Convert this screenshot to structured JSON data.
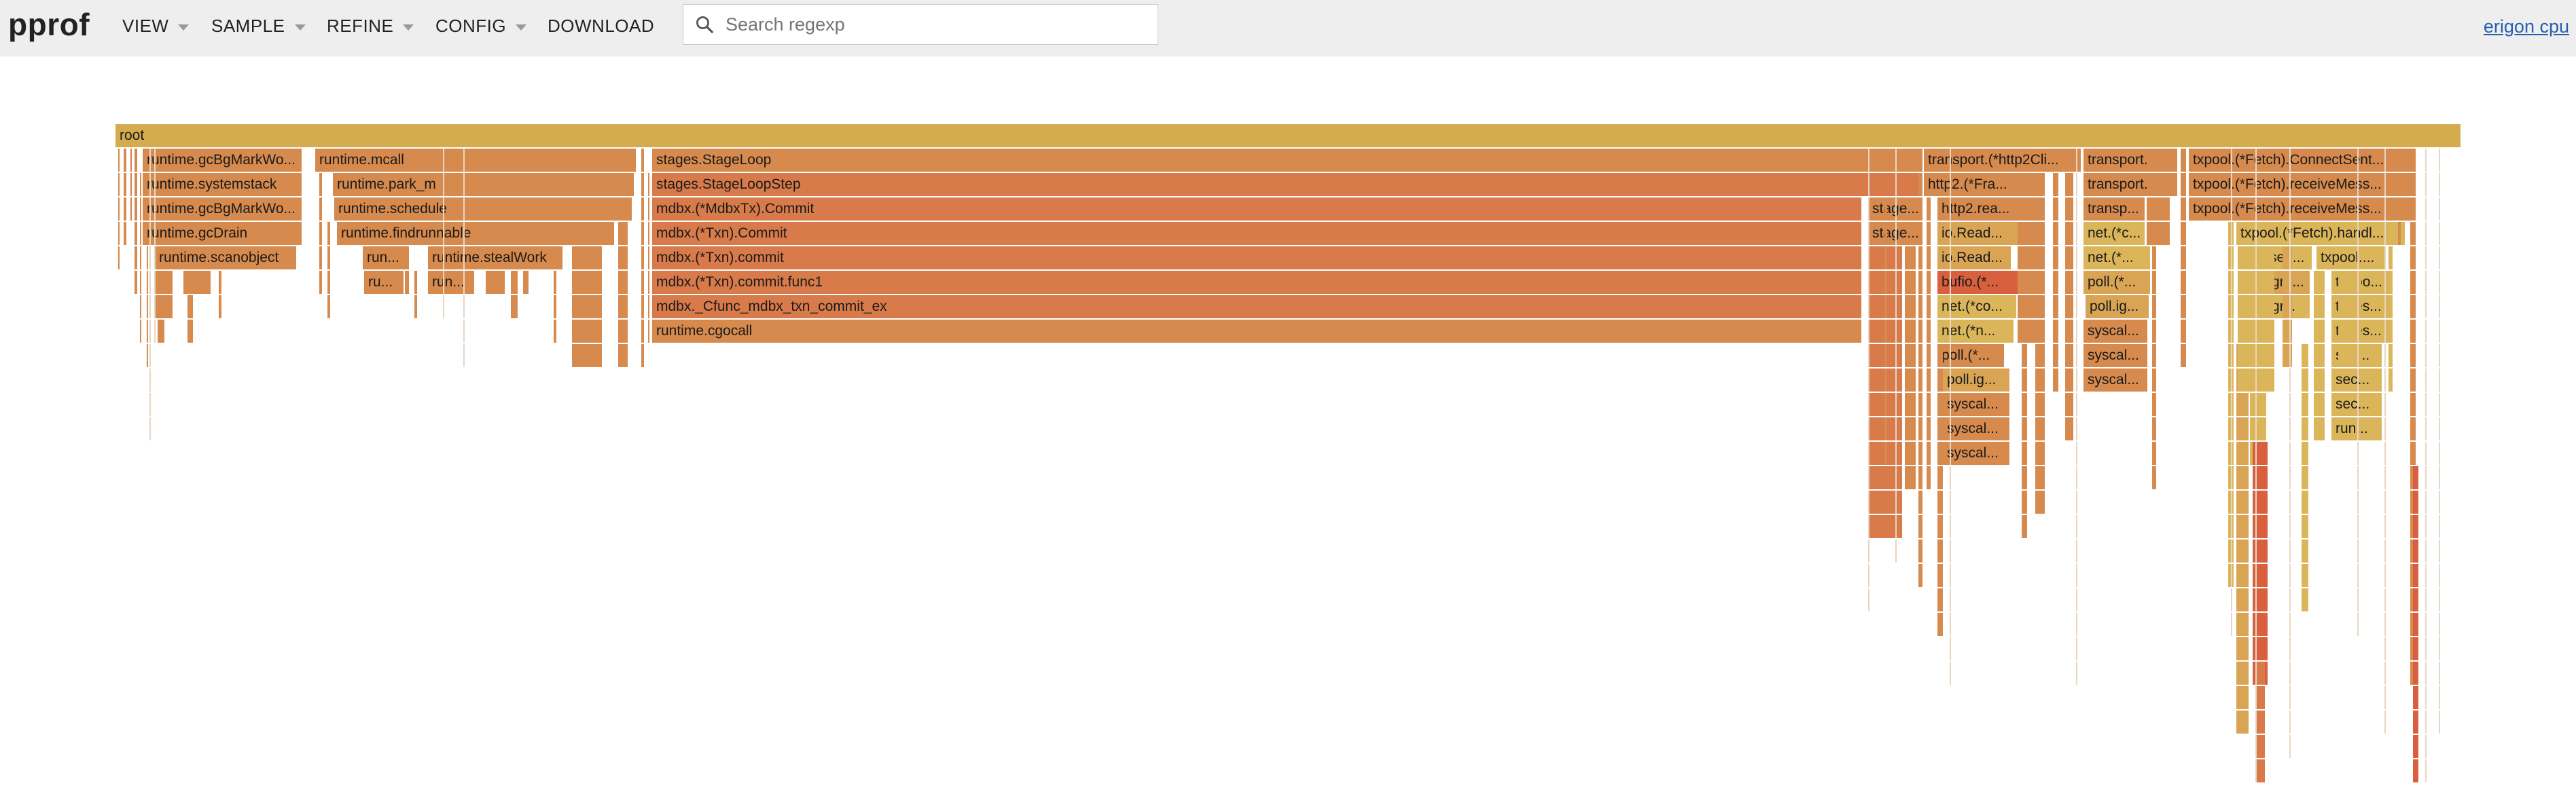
{
  "app": {
    "logo": "pprof",
    "profile_link": "erigon cpu"
  },
  "menu": [
    {
      "label": "VIEW",
      "dropdown": true
    },
    {
      "label": "SAMPLE",
      "dropdown": true
    },
    {
      "label": "REFINE",
      "dropdown": true
    },
    {
      "label": "CONFIG",
      "dropdown": true
    },
    {
      "label": "DOWNLOAD",
      "dropdown": false
    }
  ],
  "search": {
    "placeholder": "Search regexp",
    "value": "",
    "icon": "search-icon"
  },
  "colors": {
    "root": "#d5ab4f",
    "warm_orange": "#d68a4d",
    "deep_orange": "#d87a4a",
    "amber": "#d9a555",
    "gold": "#dbb55a",
    "red": "#d9603e"
  },
  "flame": {
    "rows": [
      [
        {
          "l": "root"
        }
      ],
      [
        {
          "l": "runtime.gcBgMarkWo..."
        },
        {
          "l": "runtime.mcall"
        },
        {
          "l": "stages.StageLoop"
        },
        {
          "l": "transport.(*http2Cli..."
        },
        {
          "l": "transport.n..."
        },
        {
          "l": "txpool.(*Fetch).ConnectSent..."
        }
      ],
      [
        {
          "l": "runtime.systemstack"
        },
        {
          "l": "runtime.park_m"
        },
        {
          "l": "stages.StageLoopStep"
        },
        {
          "l": "http2.(*Fra..."
        },
        {
          "l": "transport.(..."
        },
        {
          "l": "txpool.(*Fetch).receiveMess..."
        }
      ],
      [
        {
          "l": "runtime.gcBgMarkWo..."
        },
        {
          "l": "runtime.schedule"
        },
        {
          "l": "mdbx.(*MdbxTx).Commit"
        },
        {
          "l": "stage..."
        },
        {
          "l": "http2.rea..."
        },
        {
          "l": "transp..."
        },
        {
          "l": "txpool.(*Fetch).receiveMess..."
        }
      ],
      [
        {
          "l": "runtime.gcDrain"
        },
        {
          "l": "runtime.findrunnable"
        },
        {
          "l": "mdbx.(*Txn).Commit"
        },
        {
          "l": "stage..."
        },
        {
          "l": "io.Read..."
        },
        {
          "l": "net.(*c..."
        },
        {
          "l": "txpool.(*Fetch).handl..."
        }
      ],
      [
        {
          "l": "runtime.scanobject"
        },
        {
          "l": "run..."
        },
        {
          "l": "runtime.stealWork"
        },
        {
          "l": "mdbx.(*Txn).commit"
        },
        {
          "l": "io.Read..."
        },
        {
          "l": "net.(*..."
        },
        {
          "l": "sen..."
        },
        {
          "l": "txpool...."
        }
      ],
      [
        {
          "l": "ru..."
        },
        {
          "l": "run..."
        },
        {
          "l": "mdbx.(*Txn).commit.func1"
        },
        {
          "l": "bufio.(*..."
        },
        {
          "l": "poll.(*..."
        },
        {
          "l": "grp..."
        },
        {
          "l": "txpoo..."
        }
      ],
      [
        {
          "l": "mdbx._Cfunc_mdbx_txn_commit_ex"
        },
        {
          "l": "net.(*co..."
        },
        {
          "l": "poll.ig..."
        },
        {
          "l": "gr..."
        },
        {
          "l": "types..."
        }
      ],
      [
        {
          "l": "runtime.cgocall"
        },
        {
          "l": "net.(*n..."
        },
        {
          "l": "syscal..."
        },
        {
          "l": "types..."
        }
      ],
      [
        {
          "l": "poll.(*..."
        },
        {
          "l": "syscal..."
        },
        {
          "l": "sec..."
        }
      ],
      [
        {
          "l": "poll.ig..."
        },
        {
          "l": "syscal..."
        },
        {
          "l": "sec..."
        }
      ],
      [
        {
          "l": "syscal..."
        },
        {
          "l": "sec..."
        }
      ],
      [
        {
          "l": "syscal..."
        },
        {
          "l": "run..."
        }
      ],
      [
        {
          "l": "syscal..."
        }
      ]
    ]
  }
}
